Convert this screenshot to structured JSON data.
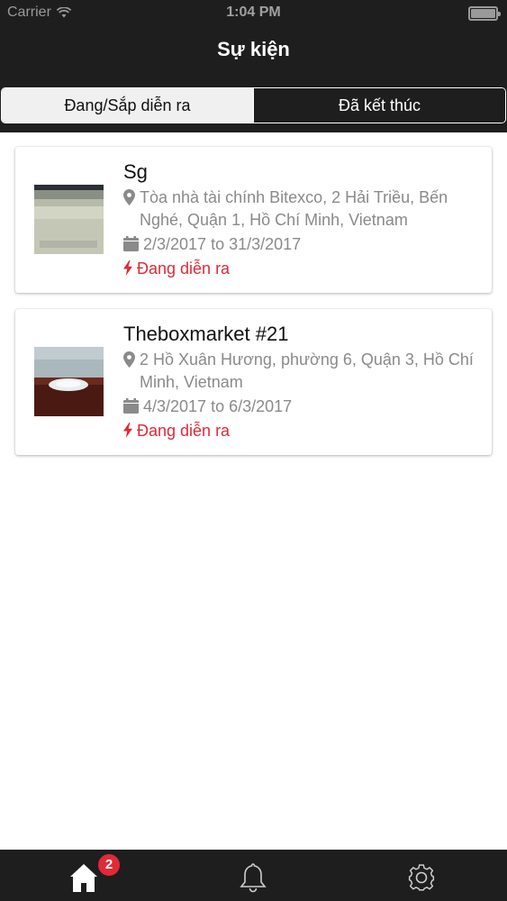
{
  "status_bar": {
    "carrier": "Carrier",
    "time": "1:04 PM"
  },
  "header": {
    "title": "Sự kiện"
  },
  "segments": [
    {
      "label": "Đang/Sắp diễn ra",
      "active": true
    },
    {
      "label": "Đã kết thúc",
      "active": false
    }
  ],
  "events": [
    {
      "title": "Sg",
      "address": "Tòa nhà tài chính Bitexco, 2 Hải Triều, Bến Nghé, Quận 1, Hồ Chí Minh, Vietnam",
      "dates": "2/3/2017 to 31/3/2017",
      "status": "Đang diễn ra"
    },
    {
      "title": "Theboxmarket #21",
      "address": "2 Hồ Xuân Hương, phường 6, Quận 3, Hồ Chí Minh, Vietnam",
      "dates": "4/3/2017 to 6/3/2017",
      "status": "Đang diễn ra"
    }
  ],
  "tabbar": {
    "items": [
      {
        "icon": "home-icon"
      },
      {
        "icon": "bell-icon"
      },
      {
        "icon": "gear-icon"
      }
    ],
    "badge": "2"
  },
  "colors": {
    "accent": "#e02a37",
    "bar": "#1e1e1e",
    "muted": "#8a8a8a"
  }
}
